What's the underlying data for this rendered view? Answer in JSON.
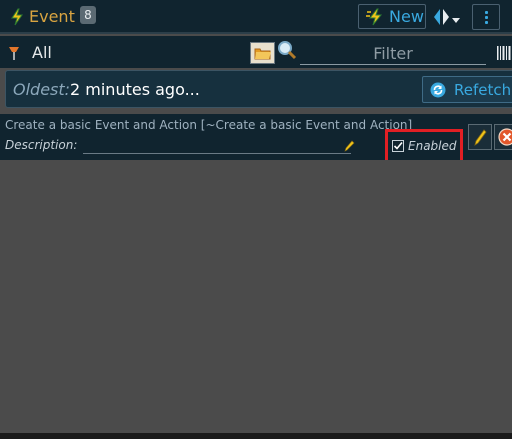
{
  "header": {
    "title": "Event",
    "count": "8",
    "new_label": "New",
    "icons": {
      "app": "lightning-icon",
      "new": "lightning-icon",
      "view": "view-toggle-icon",
      "menu": "kebab-menu-icon"
    }
  },
  "filter": {
    "scope_label": "All",
    "placeholder": "Filter",
    "value": ""
  },
  "oldest": {
    "label": "Oldest:",
    "value": "2 minutes ago...",
    "refetch_label": "Refetch"
  },
  "event": {
    "title": "Create a basic Event and Action [~Create a basic Event and Action]",
    "description_label": "Description:",
    "description_value": "",
    "enabled_label": "Enabled",
    "enabled": true
  },
  "colors": {
    "accent": "#39a9e0",
    "title": "#d9a441",
    "highlight": "#e11f24",
    "panel": "#10242f"
  }
}
